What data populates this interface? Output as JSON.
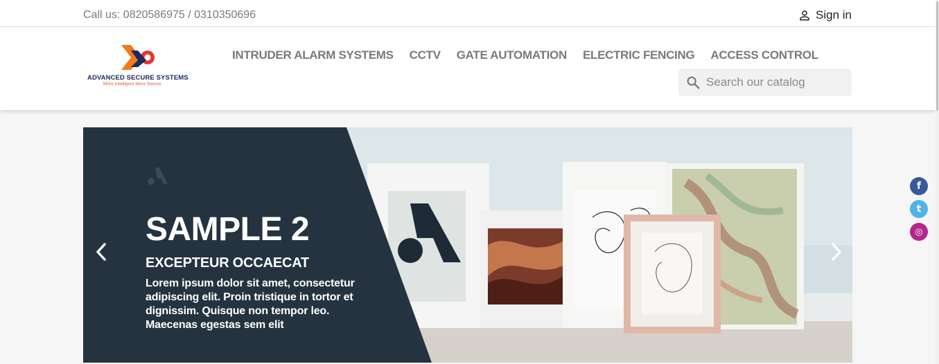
{
  "topbar": {
    "contact": "Call us: 0820586975 / 0310350696",
    "signin_label": "Sign in",
    "signin_icon": "user-icon"
  },
  "logo": {
    "brand": "ADVANCED SECURE SYSTEMS",
    "tagline": "More Intelligent More Secure",
    "colors": {
      "navy": "#1d2a5b",
      "orange": "#f07b1c",
      "red": "#e4372e"
    }
  },
  "nav": {
    "items": [
      {
        "label": "INTRUDER ALARM SYSTEMS"
      },
      {
        "label": "CCTV"
      },
      {
        "label": "GATE AUTOMATION"
      },
      {
        "label": "ELECTRIC FENCING"
      },
      {
        "label": "ACCESS CONTROL"
      }
    ]
  },
  "search": {
    "placeholder": "Search our catalog",
    "value": "",
    "icon": "search-icon"
  },
  "slider": {
    "title": "SAMPLE 2",
    "subtitle": "EXCEPTEUR OCCAECAT",
    "text": "Lorem ipsum dolor sit amet, consectetur adipiscing elit. Proin tristique in tortor et dignissim. Quisque non tempor leo. Maecenas egestas sem elit",
    "prev_icon": "chevron-left-icon",
    "next_icon": "chevron-right-icon",
    "colors": {
      "panel": "#24333f"
    }
  },
  "social": {
    "items": [
      {
        "name": "facebook-icon",
        "glyph": "f",
        "color": "#3b5998"
      },
      {
        "name": "twitter-icon",
        "glyph": "t",
        "color": "#4fb3e8"
      },
      {
        "name": "instagram-icon",
        "glyph": "◎",
        "color": "#b3278f"
      }
    ]
  }
}
